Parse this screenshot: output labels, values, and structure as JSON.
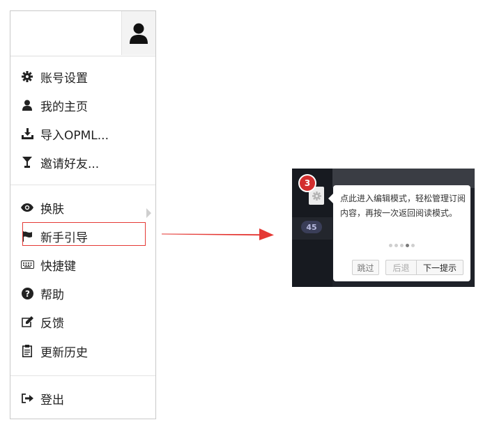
{
  "menu": {
    "items": [
      {
        "icon": "gear-icon",
        "label": "账号设置"
      },
      {
        "icon": "user-icon",
        "label": "我的主页"
      },
      {
        "icon": "download-icon",
        "label": "导入OPML..."
      },
      {
        "icon": "cocktail-glass-icon",
        "label": "邀请好友..."
      },
      {
        "icon": "eye-icon",
        "label": "换肤"
      },
      {
        "icon": "flag-icon",
        "label": "新手引导"
      },
      {
        "icon": "keyboard-icon",
        "label": "快捷键"
      },
      {
        "icon": "question-circle-icon",
        "label": "帮助"
      },
      {
        "icon": "edit-icon",
        "label": "反馈"
      },
      {
        "icon": "clipboard-icon",
        "label": "更新历史"
      },
      {
        "icon": "sign-out-icon",
        "label": "登出"
      }
    ]
  },
  "annotation": {
    "highlight_color": "#e53935",
    "arrow_color": "#e53935"
  },
  "tour": {
    "step_number": "3",
    "unread_count": "45",
    "message": "点此进入编辑模式，轻松管理订阅内容，再按一次返回阅读模式。",
    "dots_total": 5,
    "dots_active_index": 3,
    "skip_label": "跳过",
    "prev_label": "后退",
    "next_label": "下一提示"
  }
}
